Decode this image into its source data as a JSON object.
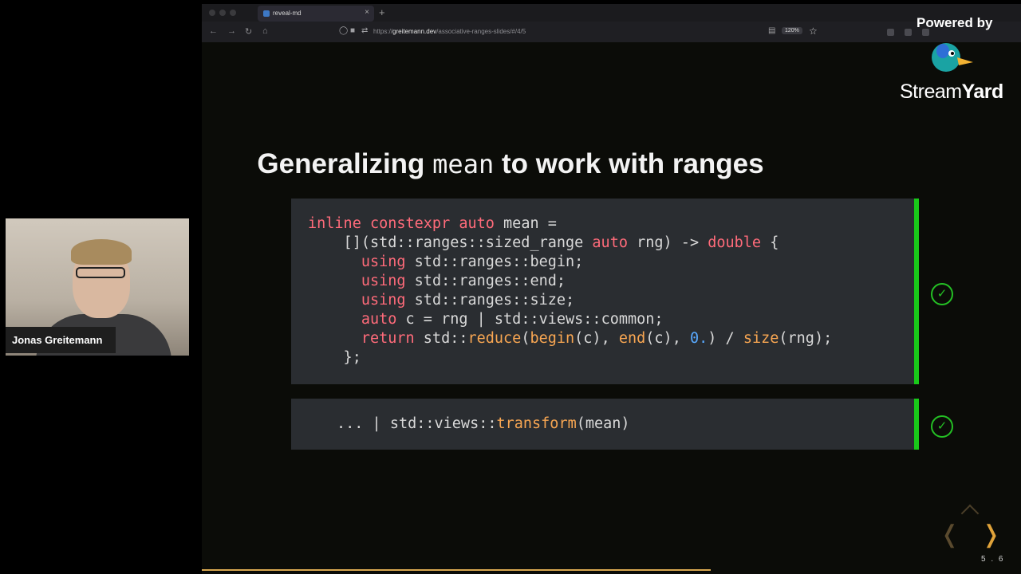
{
  "browser": {
    "tab_title": "reveal-md",
    "tab_close": "×",
    "new_tab": "+",
    "url_domain": "greitemann.dev",
    "url_path": "/associative-ranges-slides/#/4/5",
    "url_scheme": "https://",
    "zoom": "120%"
  },
  "slide": {
    "title_part1": "Generalizing ",
    "title_code": "mean",
    "title_part2": " to work with ranges",
    "slide_number": "5 . 6"
  },
  "webcam": {
    "name": "Jonas Greitemann"
  },
  "branding": {
    "powered_by": "Powered by",
    "logo_stream": "Stream",
    "logo_yard": "Yard"
  },
  "icons": {
    "check": "✓"
  },
  "colors": {
    "accent_green": "#19c819",
    "keyword": "#ff6b7a",
    "function": "#f8a652",
    "number": "#58a9ff",
    "nav_arrow": "#e0a33a"
  }
}
